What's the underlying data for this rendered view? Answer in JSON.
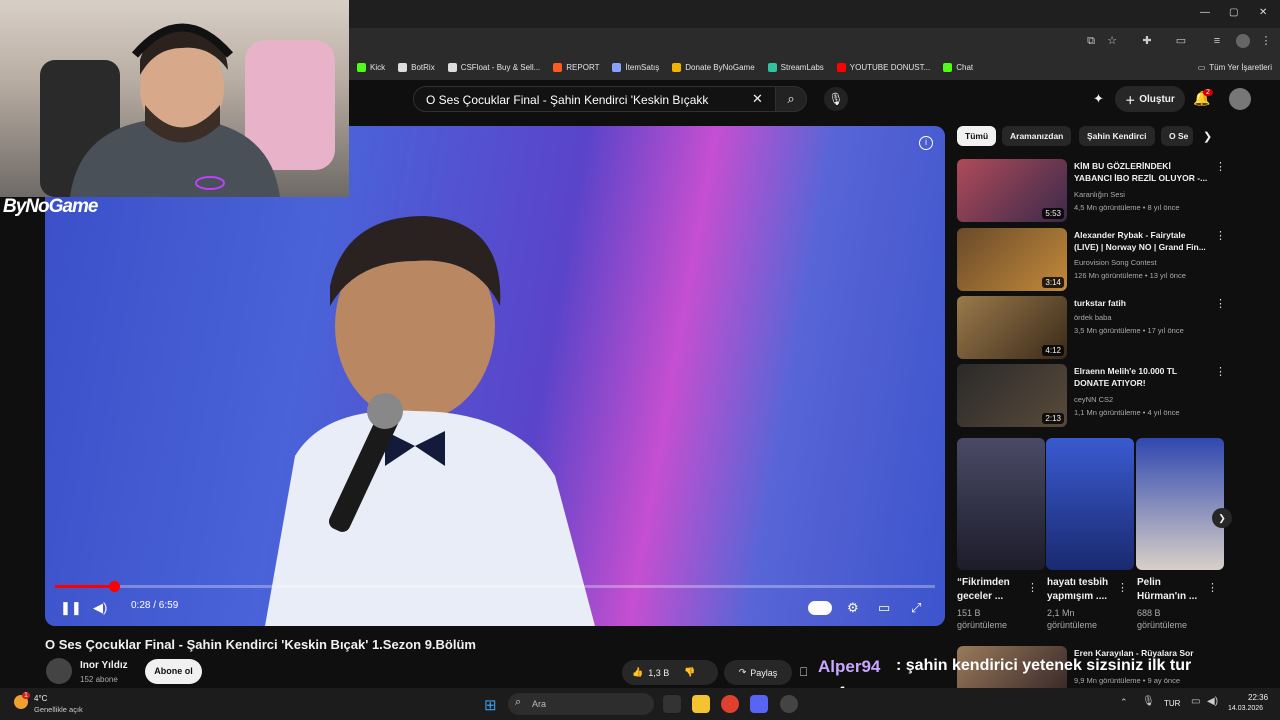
{
  "browser": {
    "bookmarks": [
      {
        "label": "Kick",
        "color": "#53fc18"
      },
      {
        "label": "BotRix",
        "color": "#dddddd"
      },
      {
        "label": "CSFloat - Buy & Sell...",
        "color": "#dddddd"
      },
      {
        "label": "REPORT",
        "color": "#ff5a1f"
      },
      {
        "label": "İtemSatış",
        "color": "#8aa0ff"
      },
      {
        "label": "Donate ByNoGame",
        "color": "#f0b400"
      },
      {
        "label": "StreamLabs",
        "color": "#31c3a2"
      },
      {
        "label": "YOUTUBE DONUST...",
        "color": "#ff0000"
      },
      {
        "label": "Chat",
        "color": "#53fc18"
      }
    ],
    "all_bookmarks": "Tüm Yer İşaretleri"
  },
  "youtube": {
    "search_query": "O Ses Çocuklar Final - Şahin Kendirci 'Keskin Bıçakk",
    "create_label": "Oluştur",
    "notification_count": "2",
    "chips": [
      "Tümü",
      "Aramanızdan",
      "Şahin Kendirci",
      "O Se"
    ]
  },
  "player": {
    "time": "0:28 / 6:59",
    "progress": 0.067,
    "title": "O Ses Çocuklar Final - Şahin Kendirci 'Keskin Bıçak' 1.Sezon 9.Bölüm",
    "channel": "Inor Yıldız",
    "subscribers": "152 abone",
    "subscribe_label": "Abone ol",
    "likes": "1,3 B",
    "share_label": "Paylaş"
  },
  "recommendations": [
    {
      "title": "KİM BU GÖZLERİNDEKİ YABANCI İBO REZİL OLUYOR -...",
      "channel": "Karanlığın Sesi",
      "meta": "4,5 Mn görüntüleme • 8 yıl önce",
      "duration": "5:53",
      "thumb_color": "#7a3a40"
    },
    {
      "title": "Alexander Rybak - Fairytale (LIVE) | Norway NO | Grand Fin...",
      "channel": "Eurovision Song Contest",
      "meta": "126 Mn görüntüleme • 13 yıl önce",
      "duration": "3:14",
      "thumb_color": "#5a3a2a"
    },
    {
      "title": "turkstar fatih",
      "channel": "ördek baba",
      "meta": "3,5 Mn görüntüleme • 17 yıl önce",
      "duration": "4:12",
      "thumb_color": "#8a6a3a"
    },
    {
      "title": "Elraenn Melih'e 10.000 TL DONATE ATIYOR!",
      "channel": "ceyNN CS2",
      "meta": "1,1 Mn görüntüleme • 4 yıl önce",
      "duration": "2:13",
      "thumb_color": "#2a2a2a"
    }
  ],
  "shorts": [
    {
      "title": "“Fikrimden geceler ...",
      "views": "151 B görüntüleme",
      "thumb_color": "#3a3a55"
    },
    {
      "title": "hayatı tesbih yapmışım ....",
      "views": "2,1 Mn görüntüleme",
      "thumb_color": "#3048a8"
    },
    {
      "title": "Pelin Hürman'ın ...",
      "views": "688 B görüntüleme",
      "thumb_color": "#2a3d8f"
    }
  ],
  "next_rec": {
    "title": "Eren Karayılan - Rüyalara Sor",
    "meta": "9,9 Mn görüntüleme • 9 ay önce"
  },
  "stream_overlay": {
    "brand": "ByNoGame",
    "chat_user": "Alper94",
    "chat_message_1": ": şahin kendirici yetenek sizsiniz ilk tur",
    "chat_message_2": "performans"
  },
  "taskbar": {
    "weather_temp": "4°C",
    "weather_desc": "Genellikle açık",
    "weather_badge": "1",
    "search_placeholder": "Ara",
    "language": "TUR",
    "time": "22:36",
    "date": "14.03.2026"
  }
}
